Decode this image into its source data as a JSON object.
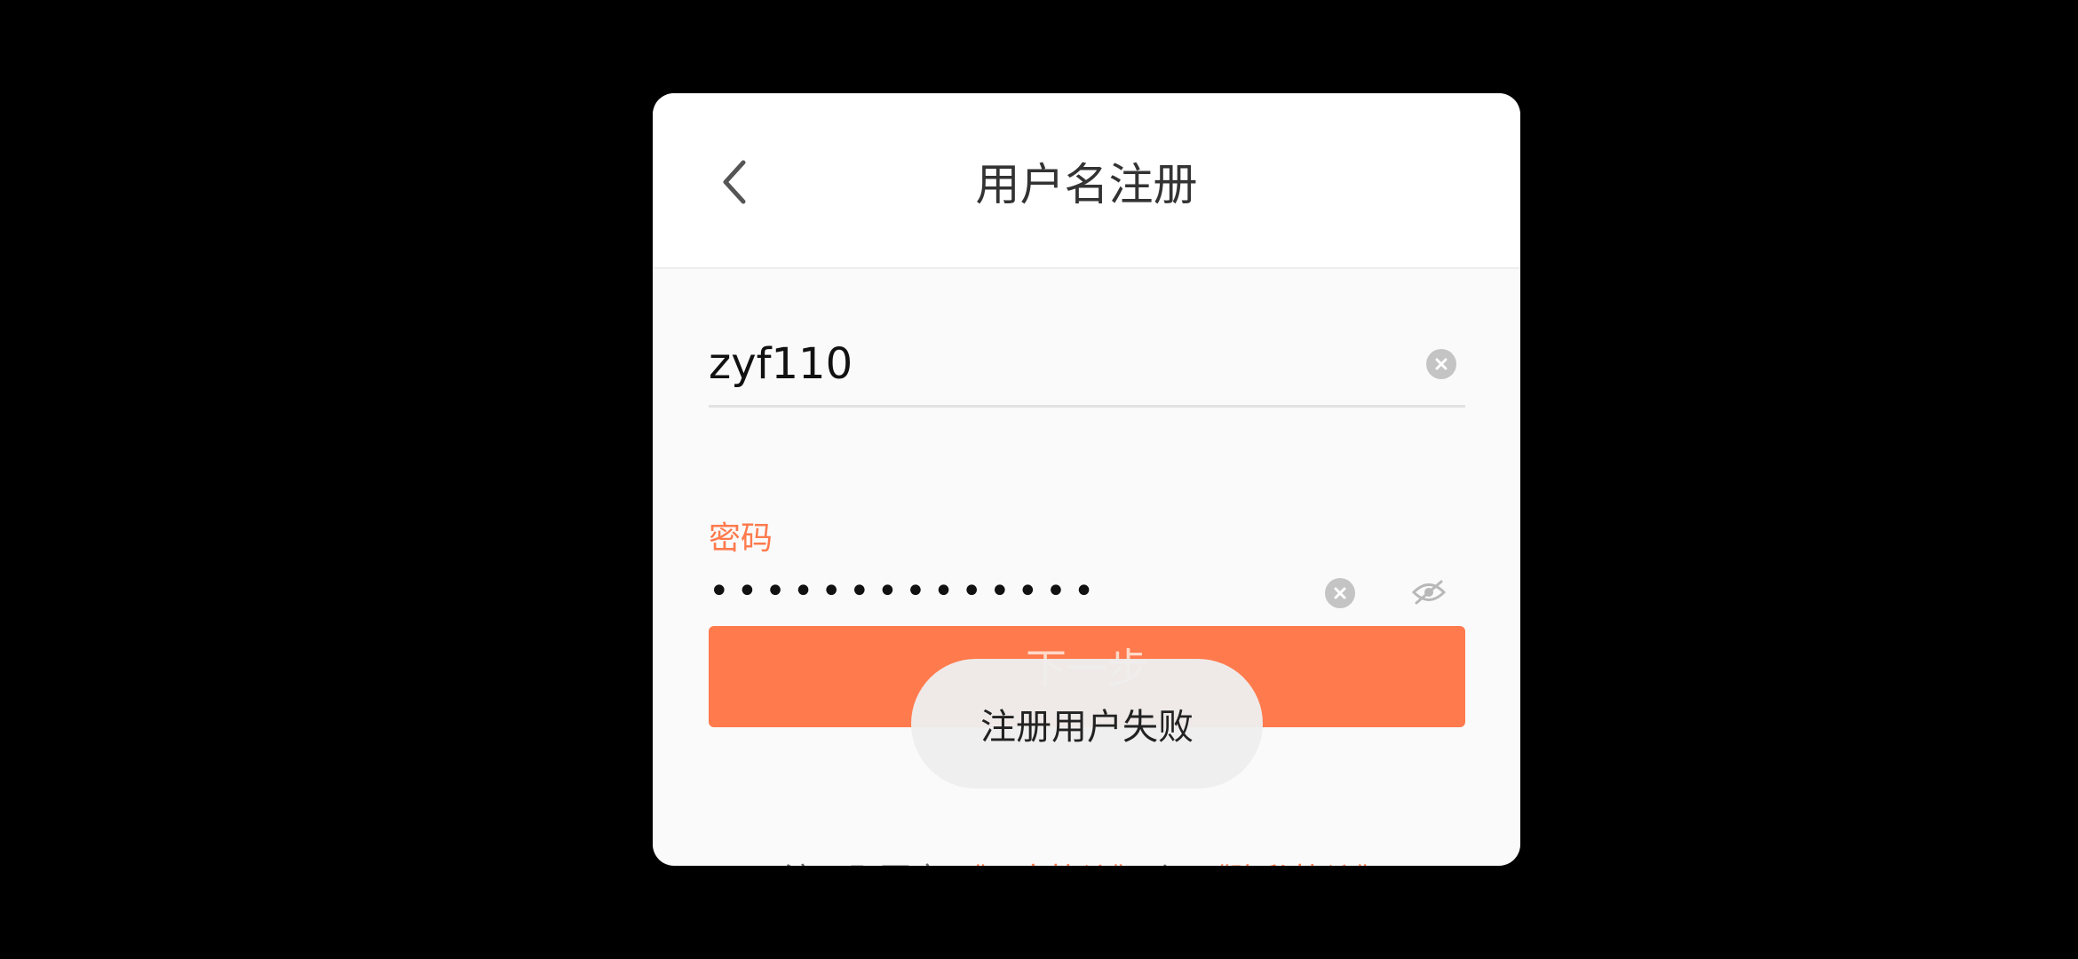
{
  "header": {
    "title": "用户名注册",
    "back_icon": "chevron-left-icon"
  },
  "form": {
    "username": {
      "value": "zyf110",
      "clear_icon": "clear-circle-icon"
    },
    "password": {
      "label": "密码",
      "masked_value": "••••••••••••••",
      "clear_icon": "clear-circle-icon",
      "visibility_icon": "eye-off-icon"
    },
    "next_label": "下一步"
  },
  "agreement": {
    "prefix": "注册即同意 ",
    "user_agreement": "《用户协议》",
    "conjunction": " 与 ",
    "privacy_policy": "《隐私协议》"
  },
  "toast": {
    "message": "注册用户失败"
  },
  "colors": {
    "accent": "#ff7a4d",
    "background": "#000000",
    "dialog": "#fafafa"
  }
}
